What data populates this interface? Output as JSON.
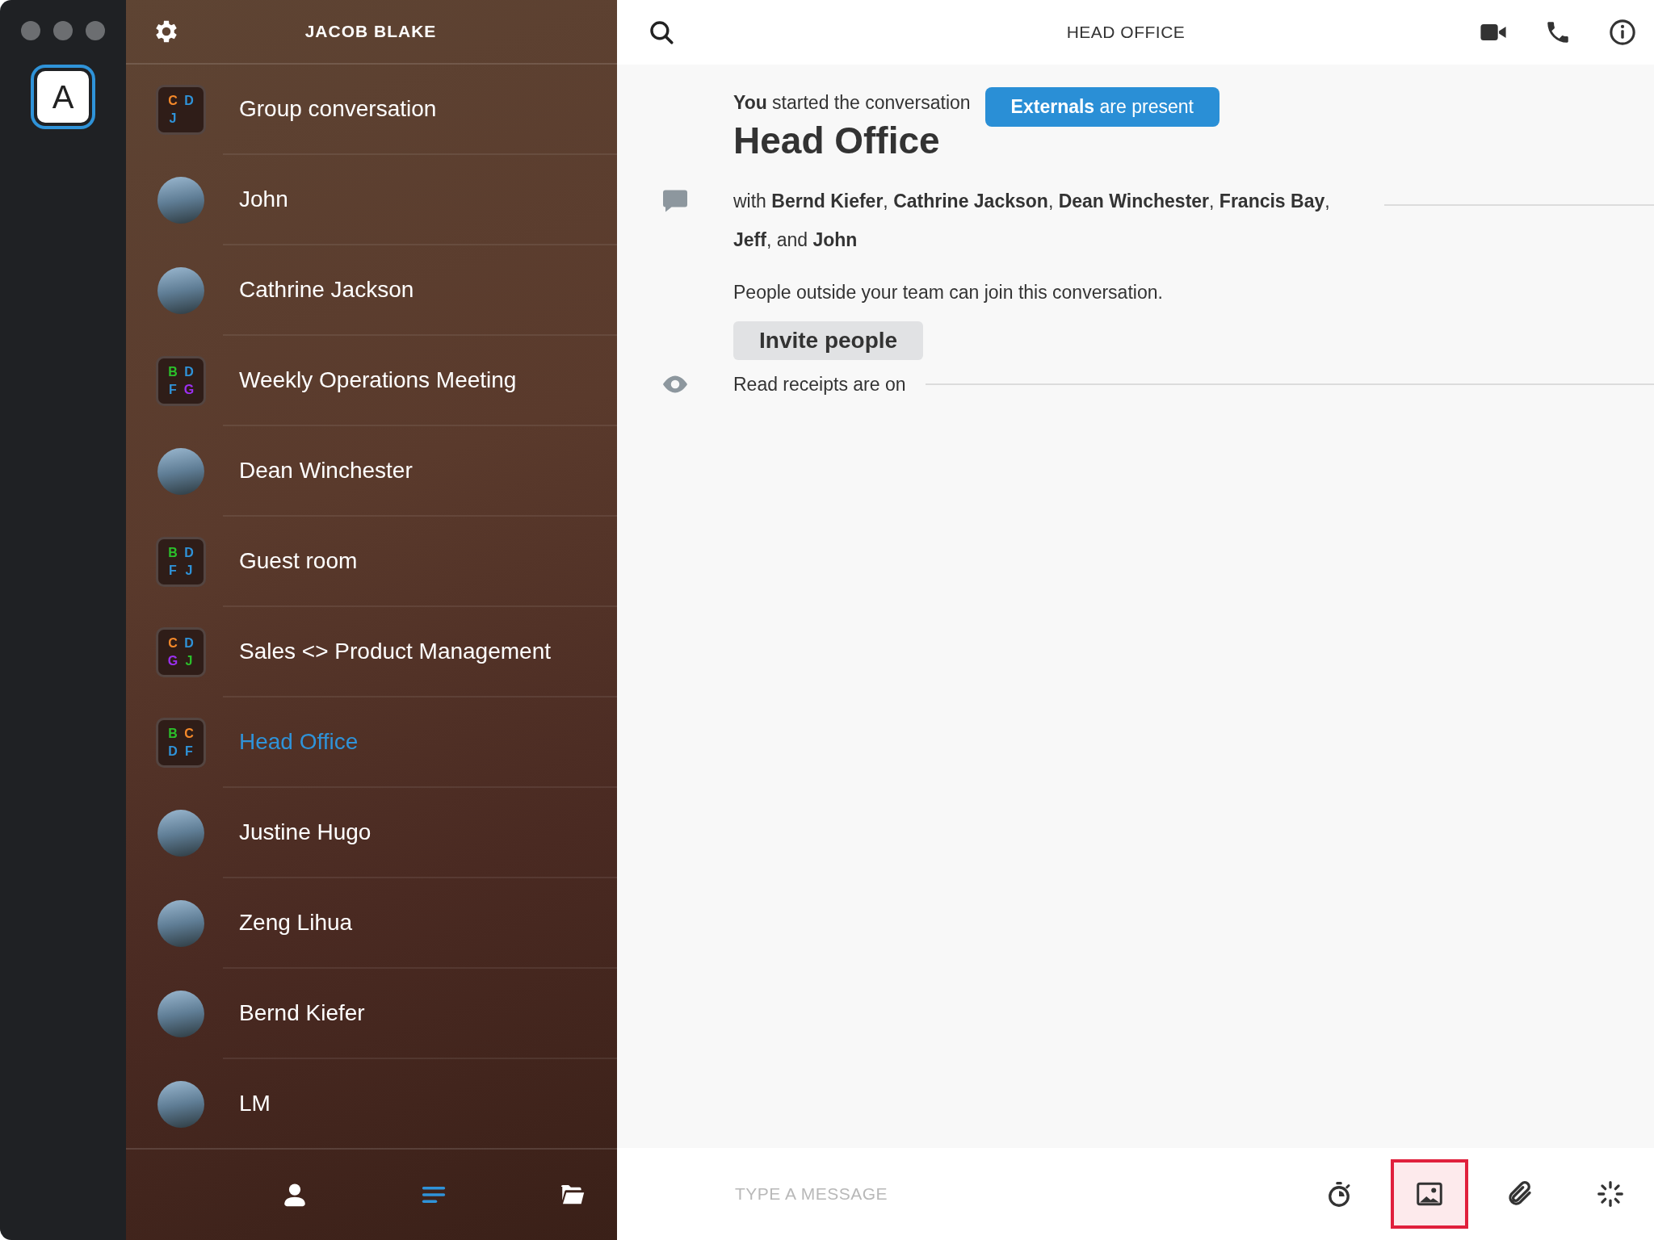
{
  "account": {
    "initial": "A",
    "selected": true
  },
  "sidebar": {
    "title": "JACOB BLAKE",
    "conversations": [
      {
        "kind": "group",
        "name": "Group conversation",
        "selected": false,
        "initials": [
          {
            "letter": "C",
            "color": "#f5892a"
          },
          {
            "letter": "D",
            "color": "#2f93d9"
          },
          {
            "letter": "J",
            "color": "#2f93d9"
          }
        ]
      },
      {
        "kind": "photo",
        "name": "John",
        "selected": false
      },
      {
        "kind": "photo",
        "name": "Cathrine Jackson",
        "selected": false
      },
      {
        "kind": "group",
        "name": "Weekly Operations Meeting",
        "selected": false,
        "initials": [
          {
            "letter": "B",
            "color": "#2bc02b"
          },
          {
            "letter": "D",
            "color": "#2f93d9"
          },
          {
            "letter": "F",
            "color": "#2f93d9"
          },
          {
            "letter": "G",
            "color": "#9b30f0"
          }
        ]
      },
      {
        "kind": "photo",
        "name": "Dean Winchester",
        "selected": false
      },
      {
        "kind": "group",
        "name": "Guest room",
        "selected": false,
        "initials": [
          {
            "letter": "B",
            "color": "#2bc02b"
          },
          {
            "letter": "D",
            "color": "#2f93d9"
          },
          {
            "letter": "F",
            "color": "#2f93d9"
          },
          {
            "letter": "J",
            "color": "#2f93d9"
          }
        ]
      },
      {
        "kind": "group",
        "name": "Sales <> Product Management",
        "selected": false,
        "initials": [
          {
            "letter": "C",
            "color": "#f5892a"
          },
          {
            "letter": "D",
            "color": "#2f93d9"
          },
          {
            "letter": "G",
            "color": "#9b30f0"
          },
          {
            "letter": "J",
            "color": "#2bc02b"
          }
        ]
      },
      {
        "kind": "group",
        "name": "Head Office",
        "selected": true,
        "initials": [
          {
            "letter": "B",
            "color": "#2bc02b"
          },
          {
            "letter": "C",
            "color": "#f5892a"
          },
          {
            "letter": "D",
            "color": "#2f93d9"
          },
          {
            "letter": "F",
            "color": "#2f93d9"
          }
        ]
      },
      {
        "kind": "photo",
        "name": "Justine Hugo",
        "selected": false
      },
      {
        "kind": "photo",
        "name": "Zeng Lihua",
        "selected": false
      },
      {
        "kind": "photo",
        "name": "Bernd Kiefer",
        "selected": false
      },
      {
        "kind": "photo",
        "name": "LM",
        "selected": false
      }
    ],
    "footer": [
      {
        "kind": "contacts",
        "selected": false
      },
      {
        "kind": "conversations",
        "selected": true
      },
      {
        "kind": "archive",
        "selected": false
      }
    ]
  },
  "conversation": {
    "title": "HEAD OFFICE",
    "started": "**You** started the conversation",
    "externals_badge": "**Externals** are present",
    "heading": "Head Office",
    "participants": "with **Bernd Kiefer**, **Cathrine Jackson**, **Dean Winchester**, **Francis Bay**, **Jeff**, and **John**",
    "guest_note": "People outside your team can join this conversation.",
    "invite_button": "Invite people",
    "receipts": "Read receipts are on"
  },
  "composer": {
    "placeholder": "TYPE A MESSAGE",
    "tools": [
      {
        "kind": "timer",
        "selected": false
      },
      {
        "kind": "image",
        "selected": true
      },
      {
        "kind": "attach",
        "selected": false
      },
      {
        "kind": "ping",
        "selected": false
      }
    ]
  }
}
